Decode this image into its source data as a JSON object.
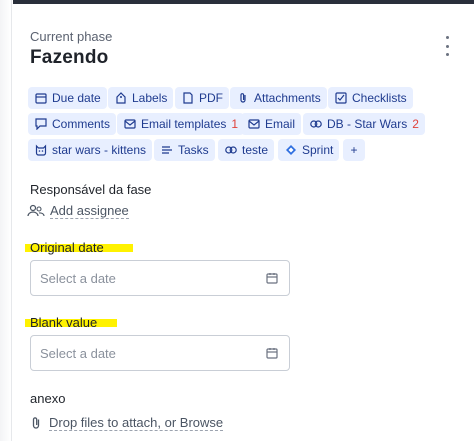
{
  "phase": {
    "label": "Current phase",
    "title": "Fazendo"
  },
  "toolbar": {
    "chips": [
      {
        "label": "Due date",
        "icon": "calendar-icon"
      },
      {
        "label": "Labels",
        "icon": "tag-icon"
      },
      {
        "label": "PDF",
        "icon": "document-icon"
      },
      {
        "label": "Attachments",
        "icon": "paperclip-icon"
      },
      {
        "label": "Checklists",
        "icon": "checklist-icon"
      },
      {
        "label": "Comments",
        "icon": "comment-icon"
      },
      {
        "label": "Email templates",
        "icon": "mail-icon",
        "count": "1"
      },
      {
        "label": "Email",
        "icon": "mail-icon"
      },
      {
        "label": "DB - Star Wars",
        "icon": "database-link-icon",
        "count": "2"
      },
      {
        "label": "star wars - kittens",
        "icon": "cat-icon"
      },
      {
        "label": "Tasks",
        "icon": "tasks-icon"
      },
      {
        "label": "teste",
        "icon": "link-icon"
      },
      {
        "label": "Sprint",
        "icon": "sprint-icon"
      },
      {
        "label": "+",
        "icon": ""
      }
    ]
  },
  "fields": {
    "responsavel": {
      "label": "Responsável da fase",
      "action": "Add assignee"
    },
    "original_date": {
      "label": "Original date",
      "placeholder": "Select a date"
    },
    "blank_value": {
      "label": "Blank value",
      "placeholder": "Select a date"
    },
    "anexo": {
      "label": "anexo",
      "action": "Drop files to attach, or Browse"
    }
  },
  "colors": {
    "chip_bg": "#e8efff",
    "chip_text": "#1f3b8f",
    "count": "#e0413b",
    "highlight": "#fff200"
  }
}
